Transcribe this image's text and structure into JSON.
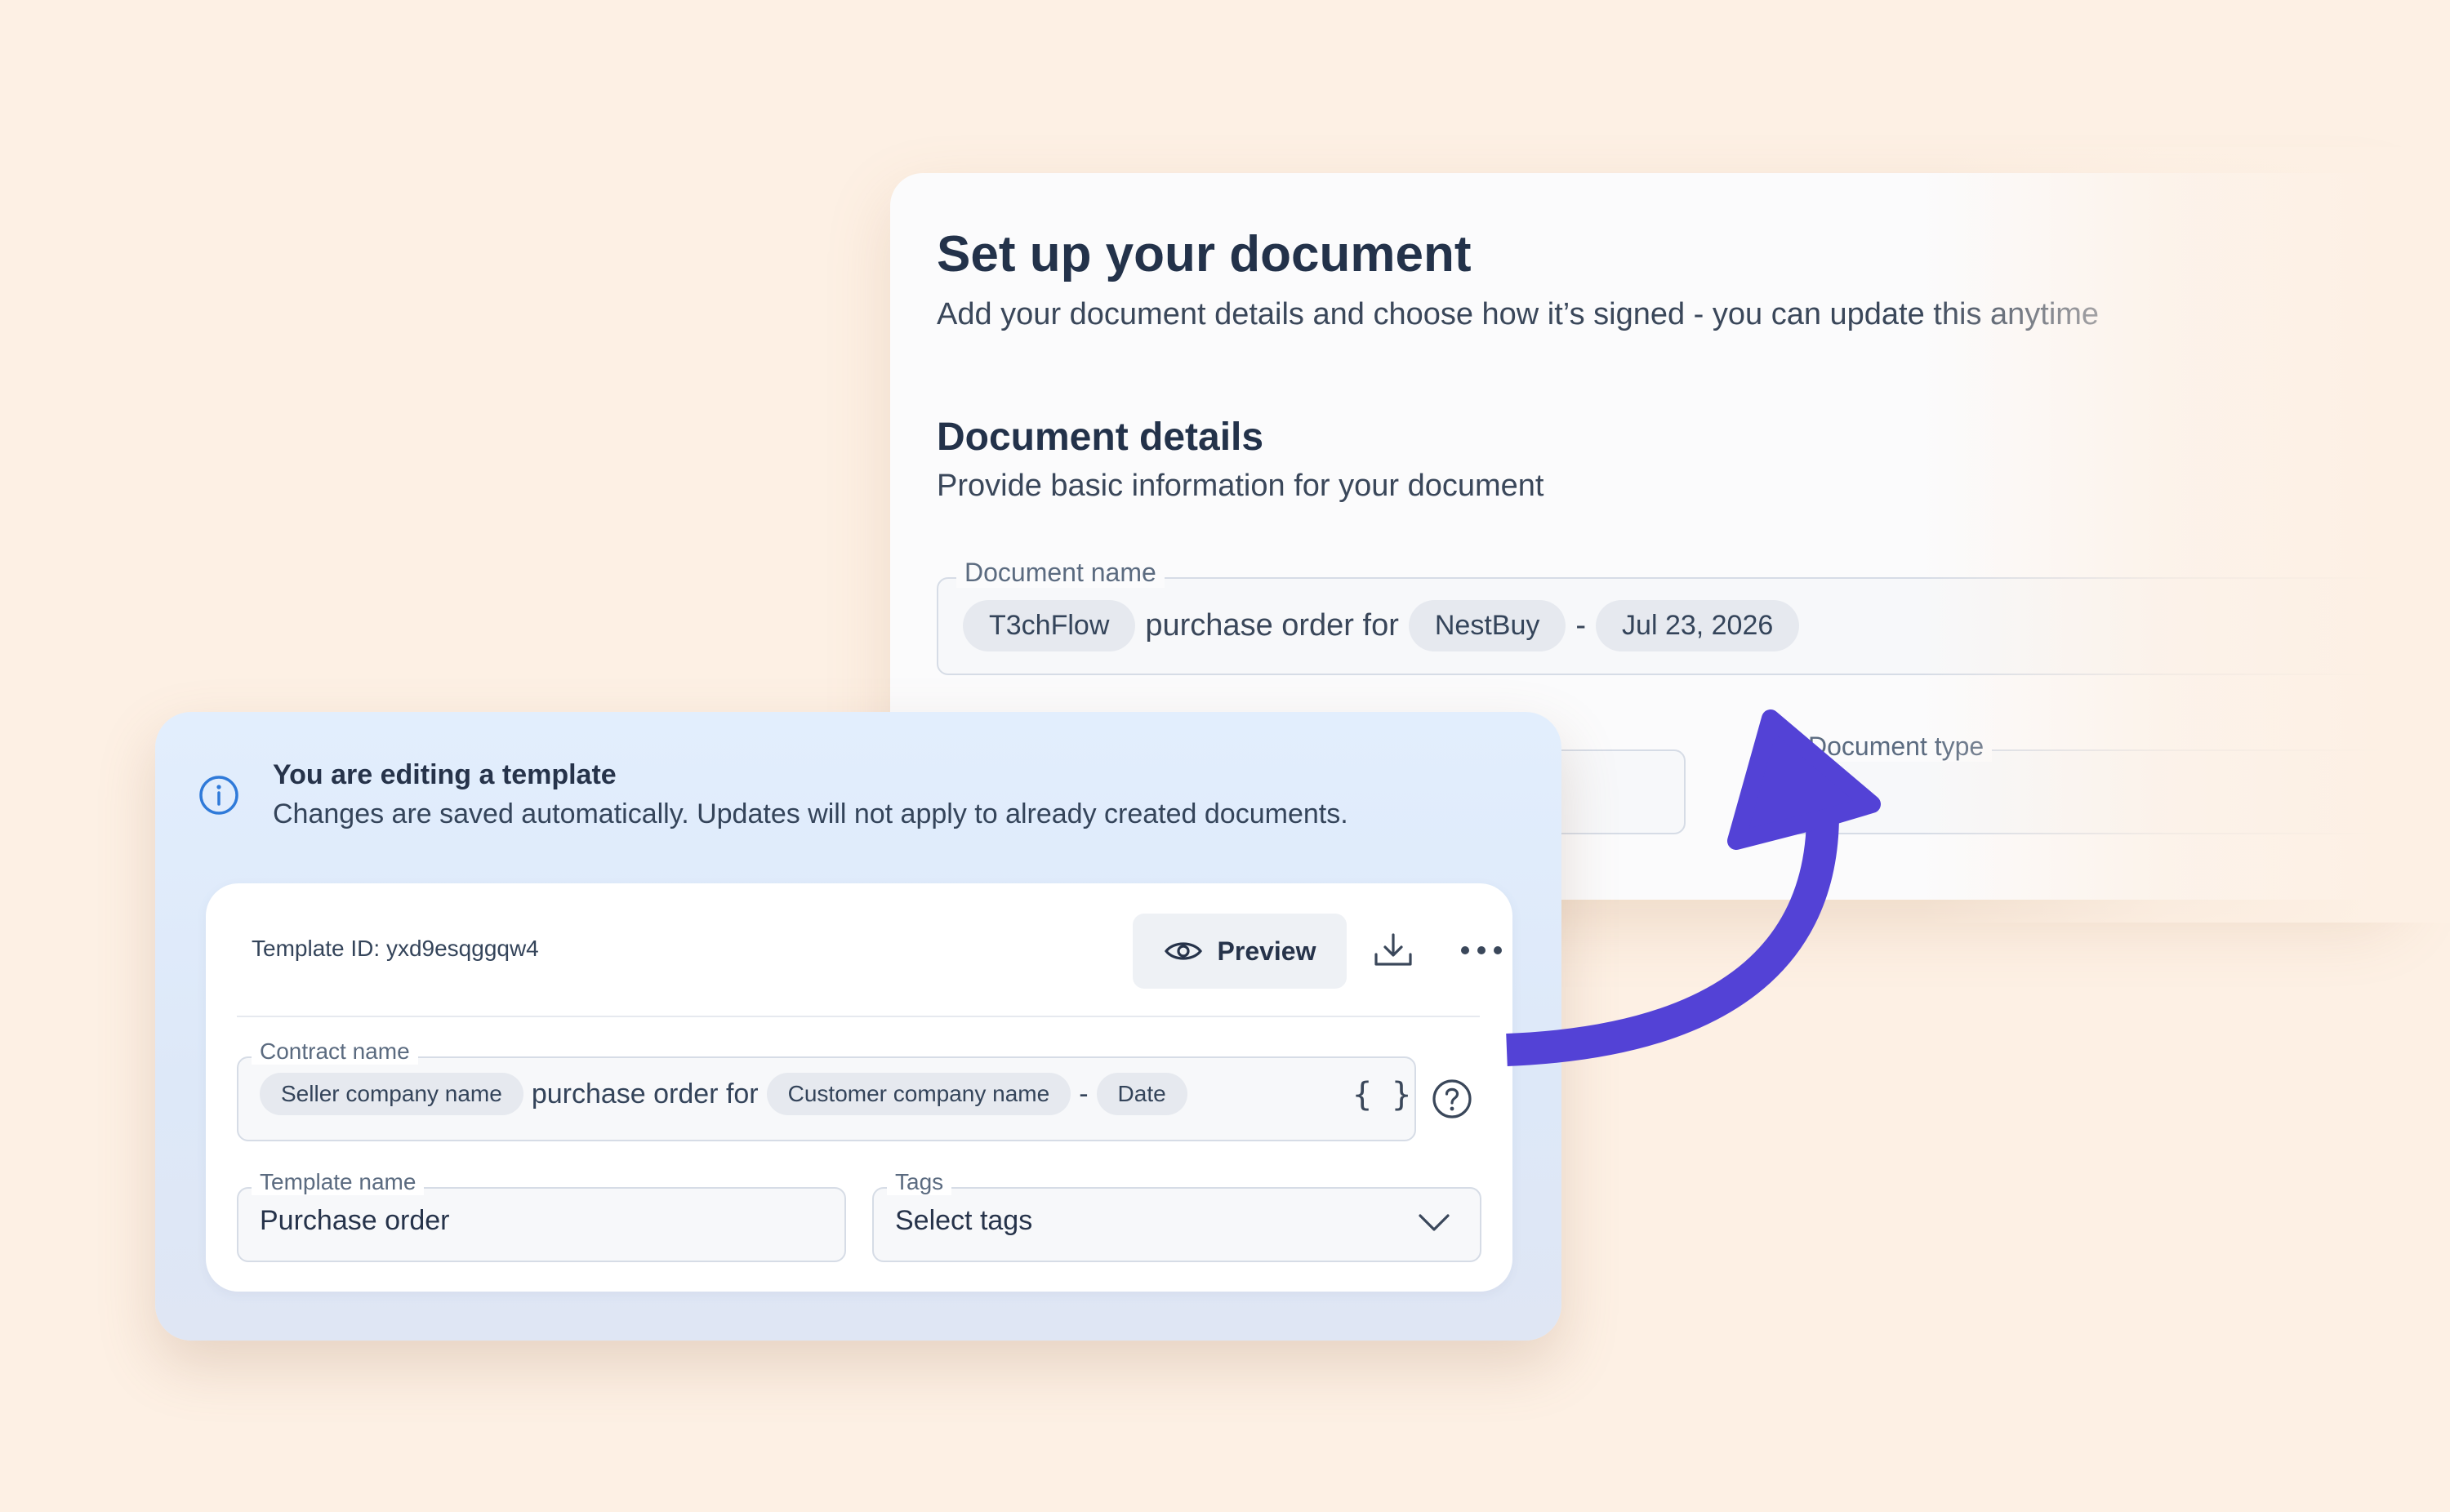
{
  "setup": {
    "title": "Set up your document",
    "subtitle": "Add your document details and choose how it’s signed - you can update this anytime",
    "section_title": "Document details",
    "section_subtitle": "Provide basic information for your document",
    "document_name": {
      "label": "Document name",
      "seller": "T3chFlow",
      "connector": "purchase order for",
      "customer": "NestBuy",
      "separator": "-",
      "date": "Jul 23, 2026"
    },
    "document_type_label": "Document type"
  },
  "template_card": {
    "banner_title": "You are editing a template",
    "banner_text": "Changes are saved automatically. Updates will not apply to already created documents.",
    "template_id": "Template ID: yxd9esqggqw4",
    "preview_label": "Preview",
    "contract_name": {
      "label": "Contract name",
      "seller_token": "Seller company name",
      "connector": "purchase order for",
      "customer_token": "Customer company name",
      "separator": "-",
      "date_token": "Date",
      "variables_glyph": "{ }"
    },
    "template_name": {
      "label": "Template name",
      "value": "Purchase order"
    },
    "tags": {
      "label": "Tags",
      "placeholder": "Select tags"
    }
  },
  "icons": [
    "info-icon",
    "eye-icon",
    "download-icon",
    "more-icon",
    "variables-icon",
    "help-icon",
    "chevron-down-icon",
    "arrow-graphic"
  ],
  "colors": {
    "background": "#fdf0e4",
    "arrow": "#5342d6",
    "banner": "#e2eefd",
    "text_dark": "#23324a"
  }
}
